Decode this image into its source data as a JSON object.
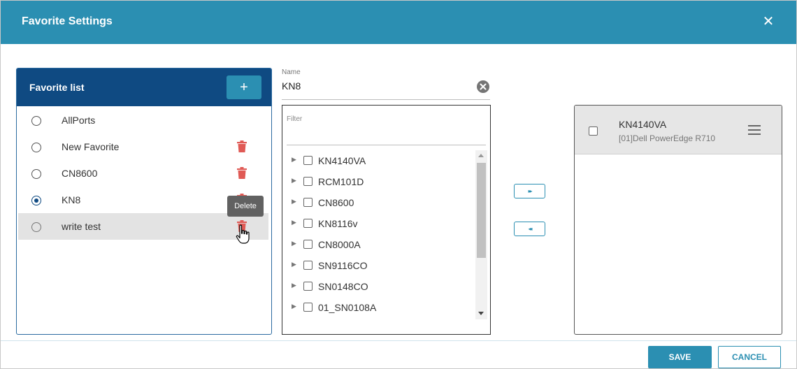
{
  "dialog": {
    "title": "Favorite Settings",
    "close_glyph": "✕"
  },
  "favorite_list": {
    "header": "Favorite list",
    "add_glyph": "+",
    "items": [
      {
        "label": "AllPorts",
        "selected": false,
        "deletable": false
      },
      {
        "label": "New Favorite",
        "selected": false,
        "deletable": true
      },
      {
        "label": "CN8600",
        "selected": false,
        "deletable": true
      },
      {
        "label": "KN8",
        "selected": true,
        "deletable": true
      },
      {
        "label": "write test",
        "selected": false,
        "deletable": true,
        "hovered": true
      }
    ],
    "tooltip": "Delete"
  },
  "name_field": {
    "caption": "Name",
    "value": "KN8"
  },
  "device_tree": {
    "filter_placeholder": "Filter",
    "items": [
      "KN4140VA",
      "RCM101D",
      "CN8600",
      "KN8116v",
      "CN8000A",
      "SN9116CO",
      "SN0148CO",
      "01_SN0108A"
    ]
  },
  "transfer": {
    "add_glyph": "▸▸",
    "remove_glyph": "◂◂"
  },
  "selected_list": {
    "items": [
      {
        "title": "KN4140VA",
        "subtitle": "[01]Dell PowerEdge R710"
      }
    ]
  },
  "footer": {
    "save_label": "SAVE",
    "cancel_label": "CANCEL"
  },
  "colors": {
    "titlebar": "#2b8fb2",
    "list_header": "#0f4a82",
    "delete_icon": "#e05a55"
  }
}
